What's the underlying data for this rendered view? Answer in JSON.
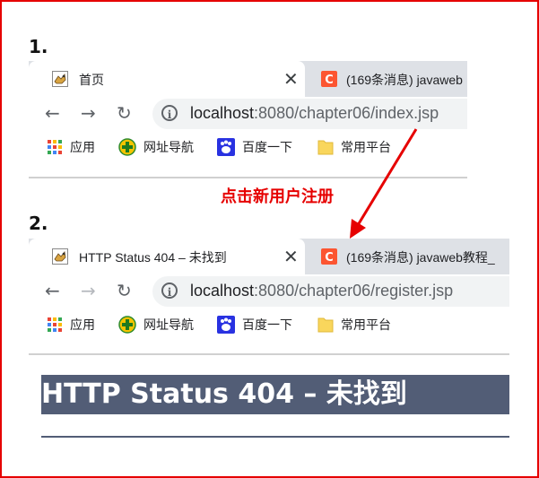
{
  "steps": {
    "one": "1.",
    "two": "2."
  },
  "browser1": {
    "active_tab": "首页",
    "inactive_tab": "(169条消息) javaweb",
    "url_host": "localhost",
    "url_path": ":8080/chapter06/index.jsp"
  },
  "browser2": {
    "active_tab": "HTTP Status 404 – 未找到",
    "inactive_tab": "(169条消息) javaweb教程_",
    "url_host": "localhost",
    "url_path": ":8080/chapter06/register.jsp"
  },
  "bookmarks": [
    {
      "label": "应用",
      "icon": "apps-grid-icon"
    },
    {
      "label": "网址导航",
      "icon": "green-plus-icon"
    },
    {
      "label": "百度一下",
      "icon": "baidu-paw-icon"
    },
    {
      "label": "常用平台",
      "icon": "folder-icon"
    }
  ],
  "annotation": "点击新用户注册",
  "error_page": {
    "heading": "HTTP Status 404 – 未找到"
  },
  "colors": {
    "frame": "#e60000",
    "annotation": "#e60000",
    "error_bar": "#525d76",
    "csdn": "#fc5531"
  }
}
